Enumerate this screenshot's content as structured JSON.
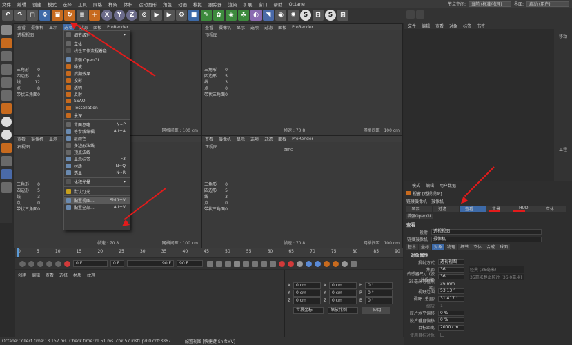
{
  "menubar": {
    "items": [
      "文件",
      "编辑",
      "创建",
      "模式",
      "选择",
      "工具",
      "网格",
      "样条",
      "体积",
      "运动图形",
      "角色",
      "动画",
      "模拟",
      "跟踪器",
      "渲染",
      "扩展",
      "窗口",
      "帮助",
      "Octane"
    ],
    "layout_label": "节点空间:",
    "layout_value": "当前 (标准/物理)",
    "interface_label": "界面:",
    "interface_value": "启动 (用户)"
  },
  "toolbar": {
    "axis_x": "X",
    "axis_y": "Y",
    "axis_z": "Z"
  },
  "viewports": {
    "menu": [
      "查看",
      "摄像机",
      "显示",
      "选项",
      "过滤",
      "面板",
      "ProRender"
    ],
    "perspective": {
      "title": "透视视图",
      "stats_labels": [
        "三角形",
        "四边形",
        "线",
        "点",
        "带状三角面"
      ],
      "stats_values": [
        "0",
        "8",
        "12",
        "8",
        "0"
      ],
      "footer": "网格间距 : 100 cm"
    },
    "top": {
      "title": "顶视图",
      "stats_values": [
        "0",
        "5",
        "3",
        "0",
        "0"
      ],
      "fps": "帧速 : 70.8",
      "footer": "网格间距 : 100 cm"
    },
    "right": {
      "title": "右视图",
      "stats_values": [
        "0",
        "5",
        "3",
        "0",
        "0"
      ],
      "fps": "帧速 : 70.8",
      "footer": "网格间距 : 100 cm"
    },
    "front": {
      "title": "正视图",
      "center_label": "ZERO",
      "fps": "帧速 : 70.8",
      "footer": "网格间距 : 100 cm"
    }
  },
  "dropdown": {
    "items": [
      {
        "label": "细节级别",
        "sc": ""
      },
      {
        "label": "立体",
        "sc": ""
      },
      {
        "label": "线性工作流程着色",
        "sc": ""
      },
      {
        "label": "增强 OpenGL",
        "sc": ""
      },
      {
        "label": "噪波",
        "sc": ""
      },
      {
        "label": "后期效果",
        "sc": ""
      },
      {
        "label": "投影",
        "sc": ""
      },
      {
        "label": "透明",
        "sc": ""
      },
      {
        "label": "反射",
        "sc": ""
      },
      {
        "label": "SSAO",
        "sc": ""
      },
      {
        "label": "Tessellation",
        "sc": ""
      },
      {
        "label": "景深",
        "sc": ""
      },
      {
        "label": "背面忽略",
        "sc": "N~P"
      },
      {
        "label": "等参线编辑",
        "sc": "Alt+A"
      },
      {
        "label": "层颜色",
        "sc": ""
      },
      {
        "label": "多边形法线",
        "sc": ""
      },
      {
        "label": "顶点法线",
        "sc": ""
      },
      {
        "label": "显示标签",
        "sc": "F3"
      },
      {
        "label": "材质",
        "sc": "N~Q"
      },
      {
        "label": "透显",
        "sc": "N~R"
      },
      {
        "label": "休积光晕",
        "sc": ""
      },
      {
        "label": "默认灯光...",
        "sc": ""
      },
      {
        "label": "配置视图...",
        "sc": "Shift+V"
      },
      {
        "label": "配置全部...",
        "sc": "Alt+V"
      }
    ]
  },
  "timeline": {
    "ticks": [
      "0",
      "5",
      "10",
      "15",
      "20",
      "25",
      "30",
      "35",
      "40",
      "45",
      "50",
      "55",
      "60",
      "65",
      "70",
      "75",
      "80",
      "85",
      "90"
    ],
    "current_frame": "0 F",
    "start": "0 F",
    "end": "90 F",
    "end2": "90 F"
  },
  "materials": {
    "menu": [
      "创建",
      "编辑",
      "查看",
      "选择",
      "材质",
      "纹理"
    ]
  },
  "coords": {
    "rows": [
      {
        "axis": "X",
        "pos": "0 cm",
        "axis2": "X",
        "size": "0 cm",
        "axis3": "H",
        "rot": "0 °"
      },
      {
        "axis": "Y",
        "pos": "0 cm",
        "axis2": "Y",
        "size": "0 cm",
        "axis3": "P",
        "rot": "0 °"
      },
      {
        "axis": "Z",
        "pos": "0 cm",
        "axis2": "Z",
        "size": "0 cm",
        "axis3": "B",
        "rot": "0 °"
      }
    ],
    "mode1": "世界坐标",
    "mode2": "缩放比例",
    "apply": "应用"
  },
  "right_panel": {
    "top_tabs": [
      "文件",
      "编辑",
      "查看",
      "对象",
      "标签",
      "书签"
    ],
    "side_buttons": [
      "移动",
      "工程"
    ],
    "attr_menu": [
      "模式",
      "编辑",
      "用户数据"
    ],
    "attr_title": "视窗 [透视视图]",
    "link_label": "链接摄像机",
    "link_value": "摄像机",
    "tabs1": [
      "显示",
      "过滤",
      "查看",
      "背景",
      "HUD",
      "立体"
    ],
    "tabs2": [
      "增强OpenGL"
    ],
    "section_title": "查看",
    "projection_label": "投射",
    "projection_value": "透视视图",
    "camera_label": "链接摄像机",
    "subtabs": [
      "基本",
      "坐标",
      "对象",
      "物理",
      "细节",
      "立体",
      "合成",
      "球面"
    ],
    "obj_props_title": "对象属性",
    "props": [
      {
        "label": "投射方式",
        "value": "透视视图"
      },
      {
        "label": "焦距",
        "value": "36",
        "hint": "经典 (36毫米)"
      },
      {
        "label": "传感器尺寸 (胶片规格)",
        "value": "36",
        "hint": "35毫米静止照片 (36.0毫米)"
      },
      {
        "label": "35毫米等值焦距:",
        "value": "36 mm",
        "hint": ""
      },
      {
        "label": "视野范围",
        "value": "53.13 °",
        "hint": ""
      },
      {
        "label": "视野 (垂直)",
        "value": "31.417 °",
        "hint": ""
      },
      {
        "label": "缩放",
        "value": "1",
        "hint": ""
      },
      {
        "label": "胶片水平偏移",
        "value": "0 %",
        "hint": ""
      },
      {
        "label": "胶片垂直偏移",
        "value": "0 %",
        "hint": ""
      },
      {
        "label": "目标距离",
        "value": "2000 cm",
        "hint": ""
      },
      {
        "label": "使用目标对象",
        "value": "",
        "hint": ""
      }
    ]
  },
  "status": {
    "text": "Octane:Collect time:13.157 ms.  Check time:21.51 ms.  chk:57  instUpd:0  cnt:3867",
    "hint": "配置视图 [快捷键 Shift+V]"
  },
  "colors": {
    "accent_red": "#e21b1b",
    "highlight_blue": "#3d6aa8"
  }
}
